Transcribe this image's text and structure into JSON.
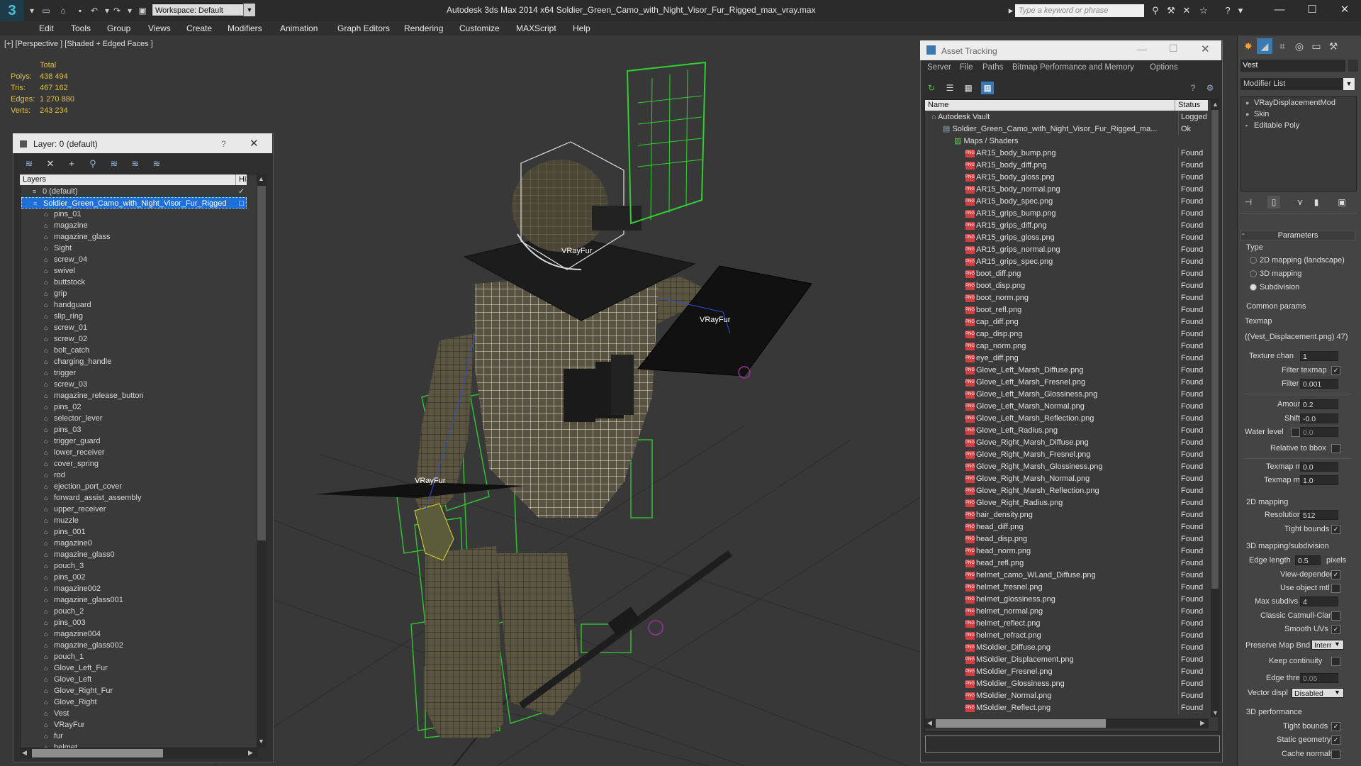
{
  "app": {
    "title": "Autodesk 3ds Max  2014 x64      Soldier_Green_Camo_with_Night_Visor_Fur_Rigged_max_vray.max",
    "workspace": "Workspace: Default",
    "search_placeholder": "Type a keyword or phrase"
  },
  "menu": [
    "Edit",
    "Tools",
    "Group",
    "Views",
    "Create",
    "Modifiers",
    "Animation",
    "Graph Editors",
    "Rendering",
    "Customize",
    "MAXScript",
    "Help"
  ],
  "viewport": {
    "label": "[+] [Perspective ] [Shaded + Edged Faces ]",
    "stats": {
      "header": "Total",
      "rows": [
        {
          "label": "Polys:",
          "value": "438 494"
        },
        {
          "label": "Tris:",
          "value": "467 162"
        },
        {
          "label": "Edges:",
          "value": "1 270 880"
        },
        {
          "label": "Verts:",
          "value": "243 234"
        }
      ]
    },
    "fur_labels": [
      "VRayFur",
      "VRayFur",
      "VRayFur"
    ]
  },
  "layer_panel": {
    "title": "Layer: 0 (default)",
    "help": "?",
    "column_layers": "Layers",
    "column_hide": "Hi",
    "items": [
      {
        "label": "0 (default)",
        "level": 0
      },
      {
        "label": "Soldier_Green_Camo_with_Night_Visor_Fur_Rigged",
        "level": 0,
        "selected": true
      },
      {
        "label": "pins_01",
        "level": 1
      },
      {
        "label": "magazine",
        "level": 1
      },
      {
        "label": "magazine_glass",
        "level": 1
      },
      {
        "label": "Sight",
        "level": 1
      },
      {
        "label": "screw_04",
        "level": 1
      },
      {
        "label": "swivel",
        "level": 1
      },
      {
        "label": "buttstock",
        "level": 1
      },
      {
        "label": "grip",
        "level": 1
      },
      {
        "label": "handguard",
        "level": 1
      },
      {
        "label": "slip_ring",
        "level": 1
      },
      {
        "label": "screw_01",
        "level": 1
      },
      {
        "label": "screw_02",
        "level": 1
      },
      {
        "label": "bolt_catch",
        "level": 1
      },
      {
        "label": "charging_handle",
        "level": 1
      },
      {
        "label": "trigger",
        "level": 1
      },
      {
        "label": "screw_03",
        "level": 1
      },
      {
        "label": "magazine_release_button",
        "level": 1
      },
      {
        "label": "pins_02",
        "level": 1
      },
      {
        "label": "selector_lever",
        "level": 1
      },
      {
        "label": "pins_03",
        "level": 1
      },
      {
        "label": "trigger_guard",
        "level": 1
      },
      {
        "label": "lower_receiver",
        "level": 1
      },
      {
        "label": "cover_spring",
        "level": 1
      },
      {
        "label": "rod",
        "level": 1
      },
      {
        "label": "ejection_port_cover",
        "level": 1
      },
      {
        "label": "forward_assist_assembly",
        "level": 1
      },
      {
        "label": "upper_receiver",
        "level": 1
      },
      {
        "label": "muzzle",
        "level": 1
      },
      {
        "label": "pins_001",
        "level": 1
      },
      {
        "label": "magazine0",
        "level": 1
      },
      {
        "label": "magazine_glass0",
        "level": 1
      },
      {
        "label": "pouch_3",
        "level": 1
      },
      {
        "label": "pins_002",
        "level": 1
      },
      {
        "label": "magazine002",
        "level": 1
      },
      {
        "label": "magazine_glass001",
        "level": 1
      },
      {
        "label": "pouch_2",
        "level": 1
      },
      {
        "label": "pins_003",
        "level": 1
      },
      {
        "label": "magazine004",
        "level": 1
      },
      {
        "label": "magazine_glass002",
        "level": 1
      },
      {
        "label": "pouch_1",
        "level": 1
      },
      {
        "label": "Glove_Left_Fur",
        "level": 1
      },
      {
        "label": "Glove_Left",
        "level": 1
      },
      {
        "label": "Glove_Right_Fur",
        "level": 1
      },
      {
        "label": "Glove_Right",
        "level": 1
      },
      {
        "label": "Vest",
        "level": 1
      },
      {
        "label": "VRayFur",
        "level": 1
      },
      {
        "label": "fur",
        "level": 1
      },
      {
        "label": "helmet",
        "level": 1
      }
    ]
  },
  "asset_tracking": {
    "title": "Asset Tracking",
    "menu": [
      "Server",
      "File",
      "Paths",
      "Bitmap Performance and Memory",
      "Options"
    ],
    "col_name": "Name",
    "col_status": "Status",
    "rows": [
      {
        "name": "Autodesk Vault",
        "status": "Logged",
        "indent": 0,
        "type": "vault"
      },
      {
        "name": "Soldier_Green_Camo_with_Night_Visor_Fur_Rigged_ma...",
        "status": "Ok",
        "indent": 1,
        "type": "file"
      },
      {
        "name": "Maps / Shaders",
        "status": "",
        "indent": 2,
        "type": "folder"
      },
      {
        "name": "AR15_body_bump.png",
        "status": "Found",
        "indent": 3,
        "type": "png"
      },
      {
        "name": "AR15_body_diff.png",
        "status": "Found",
        "indent": 3,
        "type": "png"
      },
      {
        "name": "AR15_body_gloss.png",
        "status": "Found",
        "indent": 3,
        "type": "png"
      },
      {
        "name": "AR15_body_normal.png",
        "status": "Found",
        "indent": 3,
        "type": "png"
      },
      {
        "name": "AR15_body_spec.png",
        "status": "Found",
        "indent": 3,
        "type": "png"
      },
      {
        "name": "AR15_grips_bump.png",
        "status": "Found",
        "indent": 3,
        "type": "png"
      },
      {
        "name": "AR15_grips_diff.png",
        "status": "Found",
        "indent": 3,
        "type": "png"
      },
      {
        "name": "AR15_grips_gloss.png",
        "status": "Found",
        "indent": 3,
        "type": "png"
      },
      {
        "name": "AR15_grips_normal.png",
        "status": "Found",
        "indent": 3,
        "type": "png"
      },
      {
        "name": "AR15_grips_spec.png",
        "status": "Found",
        "indent": 3,
        "type": "png"
      },
      {
        "name": "boot_diff.png",
        "status": "Found",
        "indent": 3,
        "type": "png"
      },
      {
        "name": "boot_disp.png",
        "status": "Found",
        "indent": 3,
        "type": "png"
      },
      {
        "name": "boot_norm.png",
        "status": "Found",
        "indent": 3,
        "type": "png"
      },
      {
        "name": "boot_refl.png",
        "status": "Found",
        "indent": 3,
        "type": "png"
      },
      {
        "name": "cap_diff.png",
        "status": "Found",
        "indent": 3,
        "type": "png"
      },
      {
        "name": "cap_disp.png",
        "status": "Found",
        "indent": 3,
        "type": "png"
      },
      {
        "name": "cap_norm.png",
        "status": "Found",
        "indent": 3,
        "type": "png"
      },
      {
        "name": "eye_diff.png",
        "status": "Found",
        "indent": 3,
        "type": "png"
      },
      {
        "name": "Glove_Left_Marsh_Diffuse.png",
        "status": "Found",
        "indent": 3,
        "type": "png"
      },
      {
        "name": "Glove_Left_Marsh_Fresnel.png",
        "status": "Found",
        "indent": 3,
        "type": "png"
      },
      {
        "name": "Glove_Left_Marsh_Glossiness.png",
        "status": "Found",
        "indent": 3,
        "type": "png"
      },
      {
        "name": "Glove_Left_Marsh_Normal.png",
        "status": "Found",
        "indent": 3,
        "type": "png"
      },
      {
        "name": "Glove_Left_Marsh_Reflection.png",
        "status": "Found",
        "indent": 3,
        "type": "png"
      },
      {
        "name": "Glove_Left_Radius.png",
        "status": "Found",
        "indent": 3,
        "type": "png"
      },
      {
        "name": "Glove_Right_Marsh_Diffuse.png",
        "status": "Found",
        "indent": 3,
        "type": "png"
      },
      {
        "name": "Glove_Right_Marsh_Fresnel.png",
        "status": "Found",
        "indent": 3,
        "type": "png"
      },
      {
        "name": "Glove_Right_Marsh_Glossiness.png",
        "status": "Found",
        "indent": 3,
        "type": "png"
      },
      {
        "name": "Glove_Right_Marsh_Normal.png",
        "status": "Found",
        "indent": 3,
        "type": "png"
      },
      {
        "name": "Glove_Right_Marsh_Reflection.png",
        "status": "Found",
        "indent": 3,
        "type": "png"
      },
      {
        "name": "Glove_Right_Radius.png",
        "status": "Found",
        "indent": 3,
        "type": "png"
      },
      {
        "name": "hair_density.png",
        "status": "Found",
        "indent": 3,
        "type": "png"
      },
      {
        "name": "head_diff.png",
        "status": "Found",
        "indent": 3,
        "type": "png"
      },
      {
        "name": "head_disp.png",
        "status": "Found",
        "indent": 3,
        "type": "png"
      },
      {
        "name": "head_norm.png",
        "status": "Found",
        "indent": 3,
        "type": "png"
      },
      {
        "name": "head_refl.png",
        "status": "Found",
        "indent": 3,
        "type": "png"
      },
      {
        "name": "helmet_camo_WLand_Diffuse.png",
        "status": "Found",
        "indent": 3,
        "type": "png"
      },
      {
        "name": "helmet_fresnel.png",
        "status": "Found",
        "indent": 3,
        "type": "png"
      },
      {
        "name": "helmet_glossiness.png",
        "status": "Found",
        "indent": 3,
        "type": "png"
      },
      {
        "name": "helmet_normal.png",
        "status": "Found",
        "indent": 3,
        "type": "png"
      },
      {
        "name": "helmet_reflect.png",
        "status": "Found",
        "indent": 3,
        "type": "png"
      },
      {
        "name": "helmet_refract.png",
        "status": "Found",
        "indent": 3,
        "type": "png"
      },
      {
        "name": "MSoldier_Diffuse.png",
        "status": "Found",
        "indent": 3,
        "type": "png"
      },
      {
        "name": "MSoldier_Displacement.png",
        "status": "Found",
        "indent": 3,
        "type": "png"
      },
      {
        "name": "MSoldier_Fresnel.png",
        "status": "Found",
        "indent": 3,
        "type": "png"
      },
      {
        "name": "MSoldier_Glossiness.png",
        "status": "Found",
        "indent": 3,
        "type": "png"
      },
      {
        "name": "MSoldier_Normal.png",
        "status": "Found",
        "indent": 3,
        "type": "png"
      },
      {
        "name": "MSoldier_Reflect.png",
        "status": "Found",
        "indent": 3,
        "type": "png"
      }
    ]
  },
  "command_panel": {
    "object_name": "Vest",
    "modifier_list": "Modifier List",
    "stack": [
      "VRayDisplacementMod",
      "Skin",
      "Editable Poly"
    ],
    "params_title": "Parameters",
    "type_label": "Type",
    "type_options": [
      {
        "label": "2D mapping (landscape)",
        "on": false
      },
      {
        "label": "3D mapping",
        "on": false
      },
      {
        "label": "Subdivision",
        "on": true
      }
    ],
    "common_params": "Common params",
    "texmap_label": "Texmap",
    "texmap_value": "(47 (Vest_Displacement.png))",
    "texture_chan": {
      "label": "Texture chan",
      "value": "1"
    },
    "filter_texmap": {
      "label": "Filter texmap",
      "checked": true
    },
    "filter_blur": {
      "label": "Filter blur",
      "value": "0.001"
    },
    "amount": {
      "label": "Amount",
      "value": "0.2"
    },
    "shift": {
      "label": "Shift",
      "value": "-0.0"
    },
    "water_level": {
      "label": "Water level",
      "value": "0.0"
    },
    "relative_bbox": {
      "label": "Relative to bbox",
      "checked": false
    },
    "texmap_min": {
      "label": "Texmap min",
      "value": "0.0"
    },
    "texmap_max": {
      "label": "Texmap max",
      "value": "1.0"
    },
    "mapping2d": "2D mapping",
    "resolution": {
      "label": "Resolution",
      "value": "512"
    },
    "tight_bounds_2d": {
      "label": "Tight bounds",
      "checked": true
    },
    "mapping3d": "3D mapping/subdivision",
    "edge_length": {
      "label": "Edge length",
      "value": "0.5",
      "unit": "pixels"
    },
    "view_dependent": {
      "label": "View-dependent",
      "checked": true
    },
    "use_object_mtl": {
      "label": "Use object mtl",
      "checked": false
    },
    "max_subdivs": {
      "label": "Max subdivs",
      "value": "4"
    },
    "classic_cc": {
      "label": "Classic Catmull-Clark",
      "checked": false
    },
    "smooth_uvs": {
      "label": "Smooth UVs",
      "checked": true
    },
    "preserve_map_bnd": {
      "label": "Preserve Map Bnd",
      "value": "Interr"
    },
    "keep_continuity": {
      "label": "Keep continuity",
      "checked": false
    },
    "edge_thresh": {
      "label": "Edge thresh",
      "value": "0.05"
    },
    "vector_displ": {
      "label": "Vector displ",
      "value": "Disabled"
    },
    "performance": "3D performance",
    "tight_bounds_3d": {
      "label": "Tight bounds",
      "checked": true
    },
    "static_geometry": {
      "label": "Static geometry",
      "checked": true
    },
    "cache_normals": {
      "label": "Cache normals",
      "checked": false
    }
  },
  "colors": {
    "accent": "#1e6fd8",
    "stats": "#e0c040",
    "wire_green": "#30c030",
    "wire_white": "#ffffff"
  }
}
